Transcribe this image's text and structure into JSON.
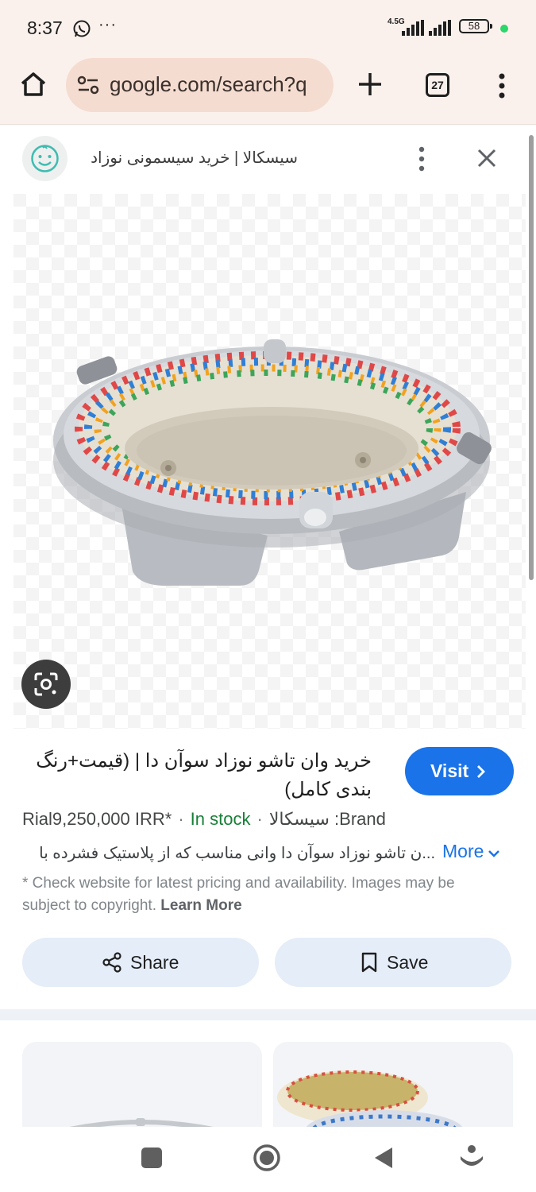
{
  "status_bar": {
    "time": "8:37",
    "notification_more": "···",
    "network_type": "4.5G",
    "battery_level": "58",
    "icons": [
      "whatsapp-icon",
      "signal-icon",
      "battery-icon"
    ]
  },
  "toolbar": {
    "url": "google.com/search?q",
    "tab_count": "27",
    "icons": [
      "home-icon",
      "site-settings-icon",
      "new-tab-plus-icon",
      "tab-switcher-icon",
      "overflow-menu-icon"
    ]
  },
  "panel": {
    "site_title": "سیسکالا | خرید سیسمونی نوزاد",
    "icons": [
      "site-favicon-icon",
      "more-vert-icon",
      "close-icon",
      "lens-icon"
    ]
  },
  "product": {
    "title": "خرید وان تاشو نوزاد سوآن دا | (قیمت+رنگ بندی کامل)",
    "visit_label": "Visit",
    "price": "Rial9,250,000 IRR*",
    "stock": "In stock",
    "brand": "Brand: سیسکالا",
    "description": "...ن تاشو نوزاد سوآن دا وانی مناسب که از پلاستیک فشرده با",
    "more_label": "More",
    "disclaimer": "* Check website for latest pricing and availability. Images may be subject to copyright.",
    "learn_more": "Learn More"
  },
  "actions": {
    "share_label": "Share",
    "save_label": "Save"
  },
  "colors": {
    "accent": "#1a73e8",
    "in_stock": "#188038",
    "toolbar_bg": "#fbf1ec",
    "url_bar_bg": "#f5dcd0",
    "pill_bg": "#e5edf8"
  }
}
